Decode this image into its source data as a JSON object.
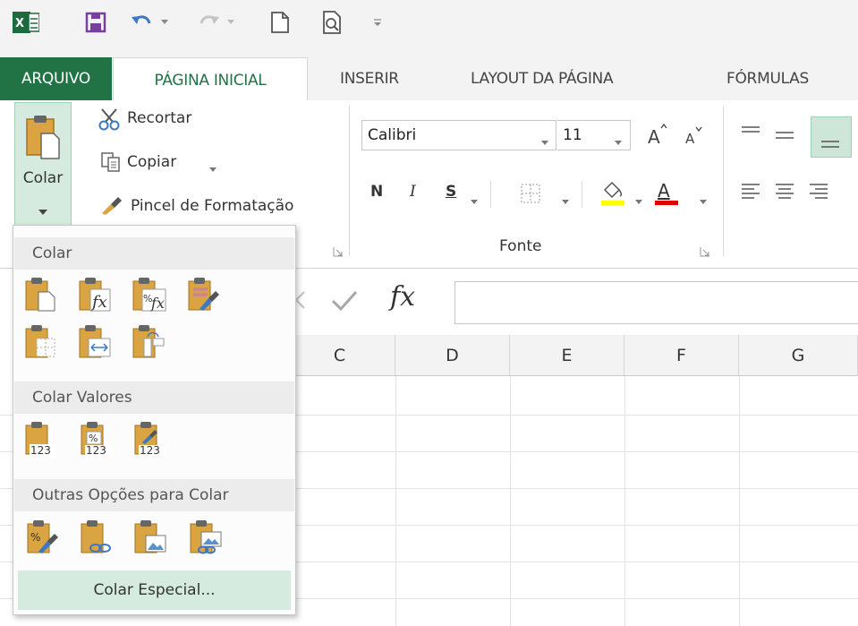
{
  "qat": {
    "icons": [
      "excel-logo-icon",
      "save-icon",
      "undo-icon",
      "redo-icon",
      "new-document-icon",
      "print-preview-icon",
      "customize-toolbar-icon"
    ]
  },
  "tabs": {
    "file": "ARQUIVO",
    "home": "PÁGINA INICIAL",
    "insert": "INSERIR",
    "page_layout": "LAYOUT DA PÁGINA",
    "formulas": "FÓRMULAS"
  },
  "clipboard": {
    "paste_label": "Colar",
    "cut_label": "Recortar",
    "copy_label": "Copiar",
    "format_painter_label": "Pincel de Formatação"
  },
  "font": {
    "font_name": "Calibri",
    "font_size": "11",
    "bold": "N",
    "italic": "I",
    "underline": "S",
    "group_label": "Fonte",
    "highlight_color": "#ffff00",
    "font_color": "#e00000"
  },
  "formula_bar": {
    "fx_label": "fx",
    "value": ""
  },
  "grid": {
    "columns": [
      "C",
      "D",
      "E",
      "F",
      "G"
    ]
  },
  "paste_menu": {
    "section_paste": "Colar",
    "section_paste_values": "Colar Valores",
    "section_other": "Outras Opções para Colar",
    "paste_special": "Colar Especial..."
  },
  "colors": {
    "accent_green": "#217346",
    "selected_green": "#d6ebdf"
  }
}
